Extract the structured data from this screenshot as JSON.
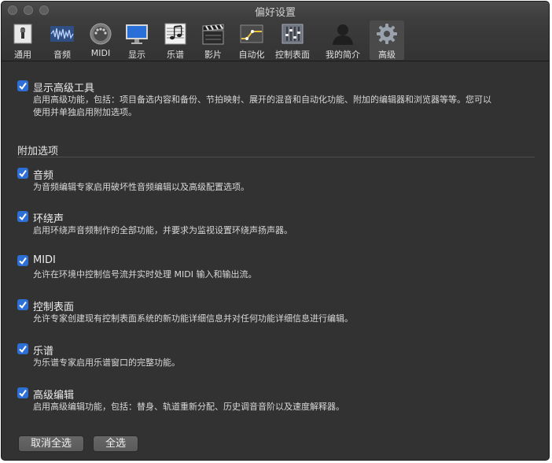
{
  "window": {
    "title": "偏好设置"
  },
  "toolbar": {
    "items": [
      {
        "label": "通用",
        "icon": "switch-icon"
      },
      {
        "label": "音频",
        "icon": "audio-waveform-icon"
      },
      {
        "label": "MIDI",
        "icon": "midi-connector-icon"
      },
      {
        "label": "显示",
        "icon": "monitor-icon"
      },
      {
        "label": "乐谱",
        "icon": "score-notes-icon"
      },
      {
        "label": "影片",
        "icon": "clapperboard-icon"
      },
      {
        "label": "自动化",
        "icon": "automation-curve-icon"
      },
      {
        "label": "控制表面",
        "icon": "control-surface-icon"
      },
      {
        "label": "我的简介",
        "icon": "profile-silhouette-icon"
      },
      {
        "label": "高级",
        "icon": "gear-icon"
      }
    ]
  },
  "advanced": {
    "title": "显示高级工具",
    "desc_line1": "启用高级功能，包括：项目备选内容和备份、节拍映射、展开的混音和自动化功能、附加的编辑器和浏览器等等。您可以",
    "desc_line2": "使用并单独启用附加选项。",
    "checked": true
  },
  "addons": {
    "section_title": "附加选项",
    "options": [
      {
        "title": "音频",
        "desc": "为音频编辑专家启用破坏性音频编辑以及高级配置选项。",
        "checked": true
      },
      {
        "title": "环绕声",
        "desc": "启用环绕声音频制作的全部功能，并要求为监视设置环绕声扬声器。",
        "checked": true
      },
      {
        "title": "MIDI",
        "desc": "允许在环境中控制信号流并实时处理 MIDI 输入和输出流。",
        "checked": true
      },
      {
        "title": "控制表面",
        "desc": "允许专家创建现有控制表面系统的新功能详细信息并对任何功能详细信息进行编辑。",
        "checked": true
      },
      {
        "title": "乐谱",
        "desc": "为乐谱专家启用乐谱窗口的完整功能。",
        "checked": true
      },
      {
        "title": "高级编辑",
        "desc": "启用高级编辑功能，包括：替身、轨道重新分配、历史调音音阶以及速度解释器。",
        "checked": true
      }
    ]
  },
  "buttons": {
    "deselect_all": "取消全选",
    "select_all": "全选"
  },
  "colors": {
    "checkbox": "#2d6fd6",
    "background": "#323232"
  }
}
